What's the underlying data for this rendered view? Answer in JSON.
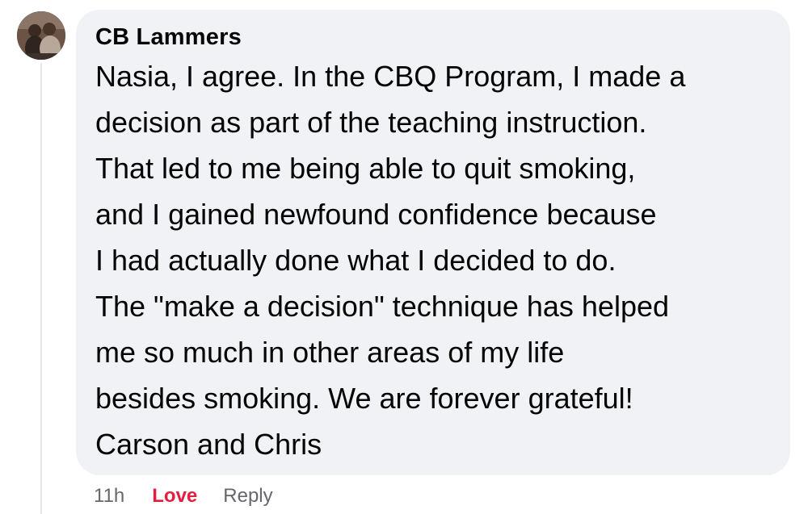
{
  "comment": {
    "author": "CB Lammers",
    "lines": [
      "Nasia, I agree. In the CBQ Program, I made a",
      "decision as part of the teaching instruction.",
      "That led to me being able to quit smoking,",
      "and I gained newfound confidence because",
      "I had actually done what I decided to do.",
      "The \"make a decision\" technique has helped",
      "me so much in other areas of my life",
      "besides smoking. We are forever grateful!",
      "Carson and Chris"
    ],
    "timestamp": "11h",
    "reaction_label": "Love",
    "reply_label": "Reply"
  },
  "colors": {
    "bubble_bg": "#f0f2f5",
    "love_red": "#e41e3f",
    "meta_gray": "#65676b",
    "thread_line": "#e4e6eb"
  }
}
